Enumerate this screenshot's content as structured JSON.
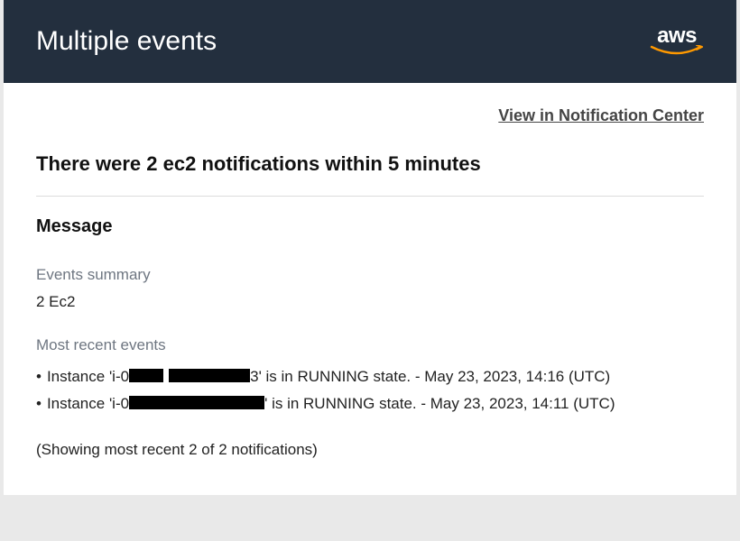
{
  "header": {
    "title": "Multiple events",
    "logo_text": "aws"
  },
  "link": {
    "view_notification_center": "View in Notification Center"
  },
  "main": {
    "heading": "There were 2 ec2 notifications within 5 minutes",
    "section_heading": "Message",
    "summary_label": "Events summary",
    "summary_value": "2 Ec2",
    "recent_label": "Most recent events",
    "events": [
      {
        "prefix": "Instance 'i-0",
        "redacted_mid_char": "3",
        "suffix": "' is in RUNNING state. - May 23, 2023, 14:16 (UTC)"
      },
      {
        "prefix": "Instance 'i-0",
        "redacted_mid_char": "",
        "suffix": "' is in RUNNING state. - May 23, 2023, 14:11 (UTC)"
      }
    ],
    "showing_text": "(Showing most recent 2 of 2 notifications)"
  }
}
